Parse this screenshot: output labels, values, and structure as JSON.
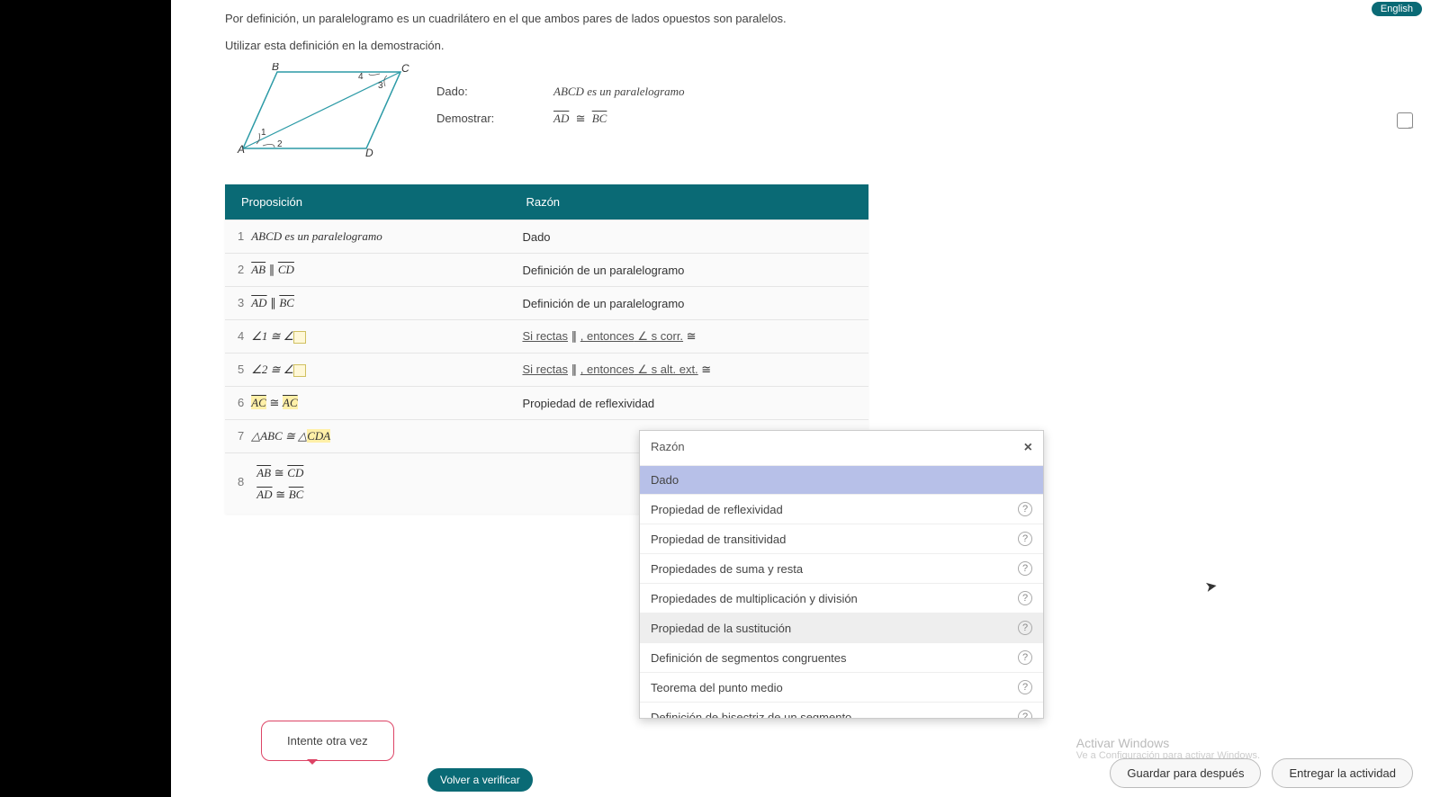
{
  "lang_btn": "English",
  "intro1": "Por definición, un paralelogramo es un cuadrilátero en el que ambos pares de lados opuestos son paralelos.",
  "intro2": "Utilizar esta definición en la demostración.",
  "figure": {
    "labels": {
      "A": "A",
      "B": "B",
      "C": "C",
      "D": "D"
    },
    "angles": {
      "1": "1",
      "2": "2",
      "3": "3",
      "4": "4"
    }
  },
  "given": {
    "lbl": "Dado:",
    "text": "ABCD es un paralelogramo"
  },
  "prove": {
    "lbl": "Demostrar:",
    "seg1": "AD",
    "cong": "≅",
    "seg2": "BC"
  },
  "columns": {
    "prop": "Proposición",
    "reason": "Razón"
  },
  "rows": [
    {
      "n": "1",
      "prop": "ABCD es un paralelogramo",
      "reason": "Dado"
    },
    {
      "n": "2",
      "prop": "AB ∥ CD",
      "seg1": "AB",
      "seg2": "CD",
      "mid": "∥",
      "reason": "Definición de un paralelogramo"
    },
    {
      "n": "3",
      "prop": "AD ∥ BC",
      "seg1": "AD",
      "seg2": "BC",
      "mid": "∥",
      "reason": "Definición de un paralelogramo"
    },
    {
      "n": "4",
      "a": "∠1 ≅ ∠",
      "reason_pre": "Si rectas",
      "reason_mid": " ∥ ",
      "reason_mid2": ", entonces",
      "reason_suf": " ∠ s corr.",
      "reason_end": " ≅"
    },
    {
      "n": "5",
      "a": "∠2 ≅ ∠",
      "reason_pre": "Si rectas",
      "reason_mid": " ∥ ",
      "reason_mid2": ", entonces",
      "reason_suf": " ∠ s alt. ext.",
      "reason_end": " ≅"
    },
    {
      "n": "6",
      "seg1": "AC",
      "mid": "≅",
      "seg2": "AC",
      "reason": "Propiedad de reflexividad"
    },
    {
      "n": "7",
      "tri": "△ABC ≅ △CDA",
      "tri_hl": "CDA",
      "tri_pre": "△ABC ≅ △"
    },
    {
      "n": "8",
      "line1_s1": "AB",
      "line1_m": "≅",
      "line1_s2": "CD",
      "line2_s1": "AD",
      "line2_m": "≅",
      "line2_s2": "BC"
    }
  ],
  "dropdown": {
    "title": "Razón",
    "items": [
      {
        "label": "Dado",
        "sel": true
      },
      {
        "label": "Propiedad de reflexividad"
      },
      {
        "label": "Propiedad de transitividad"
      },
      {
        "label": "Propiedades de suma y resta"
      },
      {
        "label": "Propiedades de multiplicación y división"
      },
      {
        "label": "Propiedad de la sustitución"
      },
      {
        "label": "Definición de segmentos congruentes"
      },
      {
        "label": "Teorema del punto medio"
      },
      {
        "label": "Definición de bisectriz de un segmento"
      }
    ]
  },
  "retry": "Intente otra vez",
  "verify": "Volver a verificar",
  "footer": {
    "save": "Guardar para después",
    "submit": "Entregar la actividad"
  },
  "activate": {
    "title": "Activar Windows",
    "sub": "Ve a Configuración para activar Windows."
  }
}
